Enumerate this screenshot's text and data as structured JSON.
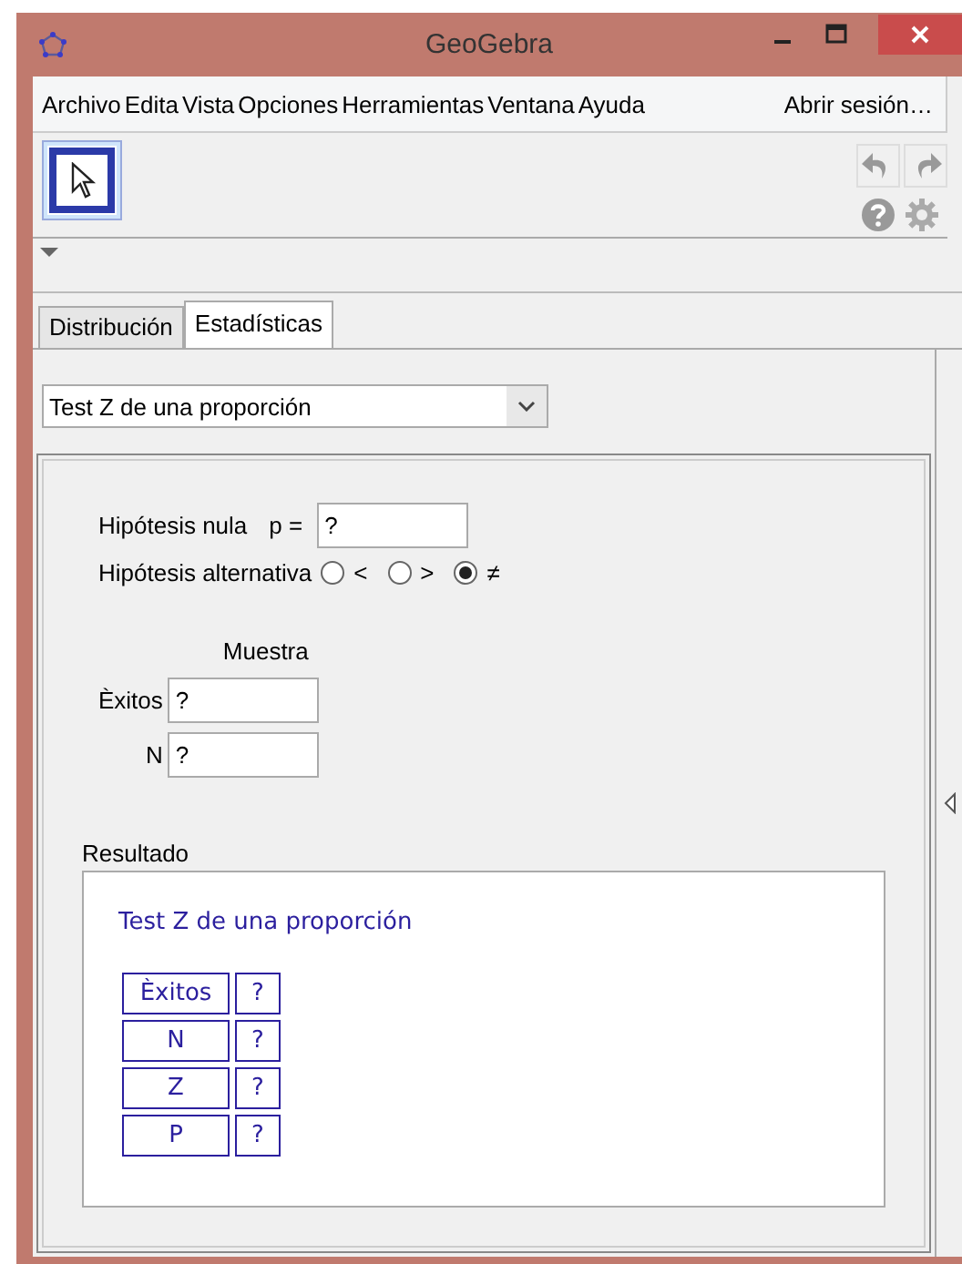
{
  "window": {
    "title": "GeoGebra"
  },
  "menu": [
    "Archivo",
    "Edita",
    "Vista",
    "Opciones",
    "Herramientas",
    "Ventana",
    "Ayuda"
  ],
  "login": "Abrir sesión…",
  "toolbar": {
    "tools": [
      {
        "selected": true
      }
    ]
  },
  "tabs": [
    {
      "label": "Distribución",
      "selected": false
    },
    {
      "label": "Estadísticas",
      "selected": true
    }
  ],
  "procedure": {
    "value": "Test Z de una proporción"
  },
  "null_hypothesis": {
    "label": "Hipótesis nula",
    "param": "p =",
    "value": "?"
  },
  "alternative": {
    "label": "Hipótesis alternativa",
    "options": [
      {
        "label": "<",
        "selected": false
      },
      {
        "label": ">",
        "selected": false
      },
      {
        "label": "≠",
        "selected": true
      }
    ]
  },
  "sample": {
    "header": "Muestra",
    "fields": [
      {
        "label": "Èxitos",
        "value": "?"
      },
      {
        "label": "N",
        "value": "?"
      }
    ]
  },
  "result": {
    "label": "Resultado",
    "title": "Test Z de una proporción",
    "rows": [
      {
        "name": "Èxitos",
        "value": "?"
      },
      {
        "name": "N",
        "value": "?"
      },
      {
        "name": "Z",
        "value": "?"
      },
      {
        "name": "P",
        "value": "?"
      }
    ]
  }
}
